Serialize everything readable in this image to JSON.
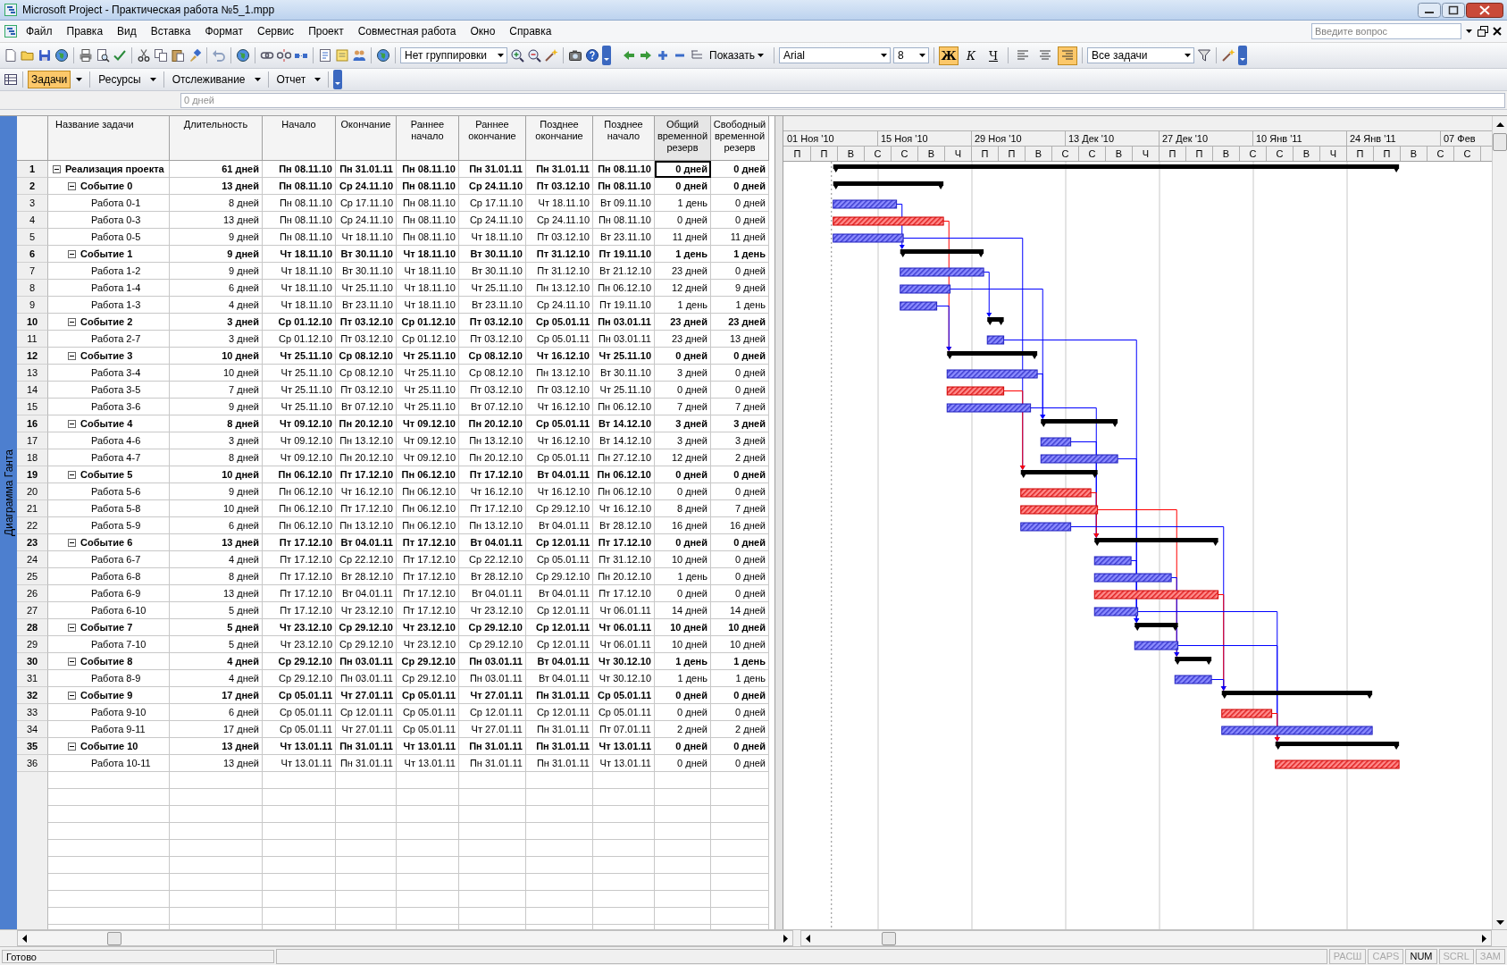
{
  "window": {
    "title": "Microsoft Project - Практическая работа №5_1.mpp"
  },
  "menu": [
    "Файл",
    "Правка",
    "Вид",
    "Вставка",
    "Формат",
    "Сервис",
    "Проект",
    "Совместная работа",
    "Окно",
    "Справка"
  ],
  "question_box": {
    "placeholder": "Введите вопрос"
  },
  "standard_toolbar": {
    "grouping": "Нет группировки"
  },
  "formatting_toolbar": {
    "show": "Показать",
    "font": "Arial",
    "size": "8",
    "styles": [
      {
        "label": "Ж",
        "kind": "bold",
        "selected": true
      },
      {
        "label": "К",
        "kind": "italic",
        "selected": false
      },
      {
        "label": "Ч",
        "kind": "underline",
        "selected": false
      }
    ],
    "alignment": [
      {
        "kind": "left",
        "selected": false
      },
      {
        "kind": "center",
        "selected": false
      },
      {
        "kind": "right",
        "selected": true
      }
    ],
    "filter": "Все задачи"
  },
  "guide_toolbar": [
    {
      "label": "Задачи",
      "selected": true
    },
    {
      "label": "Ресурсы",
      "selected": false
    },
    {
      "label": "Отслеживание",
      "selected": false
    },
    {
      "label": "Отчет",
      "selected": false
    }
  ],
  "entry_bar": {
    "value": "0 дней"
  },
  "view_bar": {
    "label": "Диаграмма Ганта"
  },
  "table": {
    "columns": [
      {
        "label": "Название задачи",
        "focused": false
      },
      {
        "label": "Длительность",
        "focused": false
      },
      {
        "label": "Начало",
        "focused": false
      },
      {
        "label": "Окончание",
        "focused": false
      },
      {
        "label": "Раннее начало",
        "focused": false
      },
      {
        "label": "Раннее окончание",
        "focused": false
      },
      {
        "label": "Позднее окончание",
        "focused": false
      },
      {
        "label": "Позднее начало",
        "focused": false
      },
      {
        "label": "Общий временной резерв",
        "focused": true
      },
      {
        "label": "Свободный временной резерв",
        "focused": false
      }
    ],
    "rows": [
      {
        "number": "1",
        "kind": "summary",
        "expanded": true,
        "focused": true,
        "cells": [
          "Реализация проекта",
          "61 дней",
          "Пн 08.11.10",
          "Пн 31.01.11",
          "Пн 08.11.10",
          "Пн 31.01.11",
          "Пн 31.01.11",
          "Пн 08.11.10",
          "0 дней",
          "0 дней"
        ],
        "children": [
          {
            "number": "2",
            "kind": "summary",
            "expanded": true,
            "focused": false,
            "cells": [
              "Событие 0",
              "13 дней",
              "Пн 08.11.10",
              "Ср 24.11.10",
              "Пн 08.11.10",
              "Ср 24.11.10",
              "Пт 03.12.10",
              "Пн 08.11.10",
              "0 дней",
              "0 дней"
            ],
            "children": [
              {
                "number": "3",
                "kind": "task",
                "critical": false,
                "focused": false,
                "cells": [
                  "Работа 0-1",
                  "8 дней",
                  "Пн 08.11.10",
                  "Ср 17.11.10",
                  "Пн 08.11.10",
                  "Ср 17.11.10",
                  "Чт 18.11.10",
                  "Вт 09.11.10",
                  "1 день",
                  "0 дней"
                ]
              },
              {
                "number": "4",
                "kind": "task",
                "critical": true,
                "focused": false,
                "cells": [
                  "Работа 0-3",
                  "13 дней",
                  "Пн 08.11.10",
                  "Ср 24.11.10",
                  "Пн 08.11.10",
                  "Ср 24.11.10",
                  "Ср 24.11.10",
                  "Пн 08.11.10",
                  "0 дней",
                  "0 дней"
                ]
              },
              {
                "number": "5",
                "kind": "task",
                "critical": false,
                "focused": false,
                "cells": [
                  "Работа 0-5",
                  "9 дней",
                  "Пн 08.11.10",
                  "Чт 18.11.10",
                  "Пн 08.11.10",
                  "Чт 18.11.10",
                  "Пт 03.12.10",
                  "Вт 23.11.10",
                  "11 дней",
                  "11 дней"
                ]
              }
            ]
          },
          {
            "number": "6",
            "kind": "summary",
            "expanded": true,
            "focused": false,
            "cells": [
              "Событие 1",
              "9 дней",
              "Чт 18.11.10",
              "Вт 30.11.10",
              "Чт 18.11.10",
              "Вт 30.11.10",
              "Пт 31.12.10",
              "Пт 19.11.10",
              "1 день",
              "1 день"
            ],
            "children": [
              {
                "number": "7",
                "kind": "task",
                "critical": false,
                "focused": false,
                "cells": [
                  "Работа 1-2",
                  "9 дней",
                  "Чт 18.11.10",
                  "Вт 30.11.10",
                  "Чт 18.11.10",
                  "Вт 30.11.10",
                  "Пт 31.12.10",
                  "Вт 21.12.10",
                  "23 дней",
                  "0 дней"
                ]
              },
              {
                "number": "8",
                "kind": "task",
                "critical": false,
                "focused": false,
                "cells": [
                  "Работа 1-4",
                  "6 дней",
                  "Чт 18.11.10",
                  "Чт 25.11.10",
                  "Чт 18.11.10",
                  "Чт 25.11.10",
                  "Пн 13.12.10",
                  "Пн 06.12.10",
                  "12 дней",
                  "9 дней"
                ]
              },
              {
                "number": "9",
                "kind": "task",
                "critical": false,
                "focused": false,
                "cells": [
                  "Работа 1-3",
                  "4 дней",
                  "Чт 18.11.10",
                  "Вт 23.11.10",
                  "Чт 18.11.10",
                  "Вт 23.11.10",
                  "Ср 24.11.10",
                  "Пт 19.11.10",
                  "1 день",
                  "1 день"
                ]
              }
            ]
          },
          {
            "number": "10",
            "kind": "summary",
            "expanded": true,
            "focused": false,
            "cells": [
              "Событие 2",
              "3 дней",
              "Ср 01.12.10",
              "Пт 03.12.10",
              "Ср 01.12.10",
              "Пт 03.12.10",
              "Ср 05.01.11",
              "Пн 03.01.11",
              "23 дней",
              "23 дней"
            ],
            "children": [
              {
                "number": "11",
                "kind": "task",
                "critical": false,
                "focused": false,
                "cells": [
                  "Работа 2-7",
                  "3 дней",
                  "Ср 01.12.10",
                  "Пт 03.12.10",
                  "Ср 01.12.10",
                  "Пт 03.12.10",
                  "Ср 05.01.11",
                  "Пн 03.01.11",
                  "23 дней",
                  "13 дней"
                ]
              }
            ]
          },
          {
            "number": "12",
            "kind": "summary",
            "expanded": true,
            "focused": false,
            "cells": [
              "Событие 3",
              "10 дней",
              "Чт 25.11.10",
              "Ср 08.12.10",
              "Чт 25.11.10",
              "Ср 08.12.10",
              "Чт 16.12.10",
              "Чт 25.11.10",
              "0 дней",
              "0 дней"
            ],
            "children": [
              {
                "number": "13",
                "kind": "task",
                "critical": false,
                "focused": false,
                "cells": [
                  "Работа 3-4",
                  "10 дней",
                  "Чт 25.11.10",
                  "Ср 08.12.10",
                  "Чт 25.11.10",
                  "Ср 08.12.10",
                  "Пн 13.12.10",
                  "Вт 30.11.10",
                  "3 дней",
                  "0 дней"
                ]
              },
              {
                "number": "14",
                "kind": "task",
                "critical": true,
                "focused": false,
                "cells": [
                  "Работа 3-5",
                  "7 дней",
                  "Чт 25.11.10",
                  "Пт 03.12.10",
                  "Чт 25.11.10",
                  "Пт 03.12.10",
                  "Пт 03.12.10",
                  "Чт 25.11.10",
                  "0 дней",
                  "0 дней"
                ]
              },
              {
                "number": "15",
                "kind": "task",
                "critical": false,
                "focused": false,
                "cells": [
                  "Работа 3-6",
                  "9 дней",
                  "Чт 25.11.10",
                  "Вт 07.12.10",
                  "Чт 25.11.10",
                  "Вт 07.12.10",
                  "Чт 16.12.10",
                  "Пн 06.12.10",
                  "7 дней",
                  "7 дней"
                ]
              }
            ]
          },
          {
            "number": "16",
            "kind": "summary",
            "expanded": true,
            "focused": false,
            "cells": [
              "Событие 4",
              "8 дней",
              "Чт 09.12.10",
              "Пн 20.12.10",
              "Чт 09.12.10",
              "Пн 20.12.10",
              "Ср 05.01.11",
              "Вт 14.12.10",
              "3 дней",
              "3 дней"
            ],
            "children": [
              {
                "number": "17",
                "kind": "task",
                "critical": false,
                "focused": false,
                "cells": [
                  "Работа 4-6",
                  "3 дней",
                  "Чт 09.12.10",
                  "Пн 13.12.10",
                  "Чт 09.12.10",
                  "Пн 13.12.10",
                  "Чт 16.12.10",
                  "Вт 14.12.10",
                  "3 дней",
                  "3 дней"
                ]
              },
              {
                "number": "18",
                "kind": "task",
                "critical": false,
                "focused": false,
                "cells": [
                  "Работа 4-7",
                  "8 дней",
                  "Чт 09.12.10",
                  "Пн 20.12.10",
                  "Чт 09.12.10",
                  "Пн 20.12.10",
                  "Ср 05.01.11",
                  "Пн 27.12.10",
                  "12 дней",
                  "2 дней"
                ]
              }
            ]
          },
          {
            "number": "19",
            "kind": "summary",
            "expanded": true,
            "focused": false,
            "cells": [
              "Событие 5",
              "10 дней",
              "Пн 06.12.10",
              "Пт 17.12.10",
              "Пн 06.12.10",
              "Пт 17.12.10",
              "Вт 04.01.11",
              "Пн 06.12.10",
              "0 дней",
              "0 дней"
            ],
            "children": [
              {
                "number": "20",
                "kind": "task",
                "critical": true,
                "focused": false,
                "cells": [
                  "Работа 5-6",
                  "9 дней",
                  "Пн 06.12.10",
                  "Чт 16.12.10",
                  "Пн 06.12.10",
                  "Чт 16.12.10",
                  "Чт 16.12.10",
                  "Пн 06.12.10",
                  "0 дней",
                  "0 дней"
                ]
              },
              {
                "number": "21",
                "kind": "task",
                "critical": true,
                "focused": false,
                "cells": [
                  "Работа 5-8",
                  "10 дней",
                  "Пн 06.12.10",
                  "Пт 17.12.10",
                  "Пн 06.12.10",
                  "Пт 17.12.10",
                  "Ср 29.12.10",
                  "Чт 16.12.10",
                  "8 дней",
                  "7 дней"
                ]
              },
              {
                "number": "22",
                "kind": "task",
                "critical": false,
                "focused": false,
                "cells": [
                  "Работа 5-9",
                  "6 дней",
                  "Пн 06.12.10",
                  "Пн 13.12.10",
                  "Пн 06.12.10",
                  "Пн 13.12.10",
                  "Вт 04.01.11",
                  "Вт 28.12.10",
                  "16 дней",
                  "16 дней"
                ]
              }
            ]
          },
          {
            "number": "23",
            "kind": "summary",
            "expanded": true,
            "focused": false,
            "cells": [
              "Событие 6",
              "13 дней",
              "Пт 17.12.10",
              "Вт 04.01.11",
              "Пт 17.12.10",
              "Вт 04.01.11",
              "Ср 12.01.11",
              "Пт 17.12.10",
              "0 дней",
              "0 дней"
            ],
            "children": [
              {
                "number": "24",
                "kind": "task",
                "critical": false,
                "focused": false,
                "cells": [
                  "Работа 6-7",
                  "4 дней",
                  "Пт 17.12.10",
                  "Ср 22.12.10",
                  "Пт 17.12.10",
                  "Ср 22.12.10",
                  "Ср 05.01.11",
                  "Пт 31.12.10",
                  "10 дней",
                  "0 дней"
                ]
              },
              {
                "number": "25",
                "kind": "task",
                "critical": false,
                "focused": false,
                "cells": [
                  "Работа 6-8",
                  "8 дней",
                  "Пт 17.12.10",
                  "Вт 28.12.10",
                  "Пт 17.12.10",
                  "Вт 28.12.10",
                  "Ср 29.12.10",
                  "Пн 20.12.10",
                  "1 день",
                  "0 дней"
                ]
              },
              {
                "number": "26",
                "kind": "task",
                "critical": true,
                "focused": false,
                "cells": [
                  "Работа 6-9",
                  "13 дней",
                  "Пт 17.12.10",
                  "Вт 04.01.11",
                  "Пт 17.12.10",
                  "Вт 04.01.11",
                  "Вт 04.01.11",
                  "Пт 17.12.10",
                  "0 дней",
                  "0 дней"
                ]
              },
              {
                "number": "27",
                "kind": "task",
                "critical": false,
                "focused": false,
                "cells": [
                  "Работа 6-10",
                  "5 дней",
                  "Пт 17.12.10",
                  "Чт 23.12.10",
                  "Пт 17.12.10",
                  "Чт 23.12.10",
                  "Ср 12.01.11",
                  "Чт 06.01.11",
                  "14 дней",
                  "14 дней"
                ]
              }
            ]
          },
          {
            "number": "28",
            "kind": "summary",
            "expanded": true,
            "focused": false,
            "cells": [
              "Событие 7",
              "5 дней",
              "Чт 23.12.10",
              "Ср 29.12.10",
              "Чт 23.12.10",
              "Ср 29.12.10",
              "Ср 12.01.11",
              "Чт 06.01.11",
              "10 дней",
              "10 дней"
            ],
            "children": [
              {
                "number": "29",
                "kind": "task",
                "critical": false,
                "focused": false,
                "cells": [
                  "Работа 7-10",
                  "5 дней",
                  "Чт 23.12.10",
                  "Ср 29.12.10",
                  "Чт 23.12.10",
                  "Ср 29.12.10",
                  "Ср 12.01.11",
                  "Чт 06.01.11",
                  "10 дней",
                  "10 дней"
                ]
              }
            ]
          },
          {
            "number": "30",
            "kind": "summary",
            "expanded": true,
            "focused": false,
            "cells": [
              "Событие 8",
              "4 дней",
              "Ср 29.12.10",
              "Пн 03.01.11",
              "Ср 29.12.10",
              "Пн 03.01.11",
              "Вт 04.01.11",
              "Чт 30.12.10",
              "1 день",
              "1 день"
            ],
            "children": [
              {
                "number": "31",
                "kind": "task",
                "critical": false,
                "focused": false,
                "cells": [
                  "Работа 8-9",
                  "4 дней",
                  "Ср 29.12.10",
                  "Пн 03.01.11",
                  "Ср 29.12.10",
                  "Пн 03.01.11",
                  "Вт 04.01.11",
                  "Чт 30.12.10",
                  "1 день",
                  "1 день"
                ]
              }
            ]
          },
          {
            "number": "32",
            "kind": "summary",
            "expanded": true,
            "focused": false,
            "cells": [
              "Событие 9",
              "17 дней",
              "Ср 05.01.11",
              "Чт 27.01.11",
              "Ср 05.01.11",
              "Чт 27.01.11",
              "Пн 31.01.11",
              "Ср 05.01.11",
              "0 дней",
              "0 дней"
            ],
            "children": [
              {
                "number": "33",
                "kind": "task",
                "critical": true,
                "focused": false,
                "cells": [
                  "Работа 9-10",
                  "6 дней",
                  "Ср 05.01.11",
                  "Ср 12.01.11",
                  "Ср 05.01.11",
                  "Ср 12.01.11",
                  "Ср 12.01.11",
                  "Ср 05.01.11",
                  "0 дней",
                  "0 дней"
                ]
              },
              {
                "number": "34",
                "kind": "task",
                "critical": false,
                "focused": false,
                "cells": [
                  "Работа 9-11",
                  "17 дней",
                  "Ср 05.01.11",
                  "Чт 27.01.11",
                  "Ср 05.01.11",
                  "Чт 27.01.11",
                  "Пн 31.01.11",
                  "Пт 07.01.11",
                  "2 дней",
                  "2 дней"
                ]
              }
            ]
          },
          {
            "number": "35",
            "kind": "summary",
            "expanded": true,
            "focused": false,
            "cells": [
              "Событие 10",
              "13 дней",
              "Чт 13.01.11",
              "Пн 31.01.11",
              "Чт 13.01.11",
              "Пн 31.01.11",
              "Пн 31.01.11",
              "Чт 13.01.11",
              "0 дней",
              "0 дней"
            ],
            "children": [
              {
                "number": "36",
                "kind": "task",
                "critical": true,
                "focused": false,
                "cells": [
                  "Работа 10-11",
                  "13 дней",
                  "Чт 13.01.11",
                  "Пн 31.01.11",
                  "Чт 13.01.11",
                  "Пн 31.01.11",
                  "Пн 31.01.11",
                  "Чт 13.01.11",
                  "0 дней",
                  "0 дней"
                ]
              }
            ]
          }
        ]
      }
    ]
  },
  "gantt": {
    "timescale": {
      "major": [
        "01 Ноя '10",
        "15 Ноя '10",
        "29 Ноя '10",
        "13 Дек '10",
        "27 Дек '10",
        "10 Янв '11",
        "24 Янв '11",
        "07 Фев"
      ],
      "minor": [
        "П",
        "П",
        "В",
        "С",
        "С",
        "В",
        "Ч",
        "П",
        "П",
        "В",
        "С",
        "С",
        "В",
        "Ч",
        "П",
        "П",
        "В",
        "С",
        "С",
        "В",
        "Ч",
        "П",
        "П",
        "В",
        "С",
        "С"
      ]
    }
  },
  "status_bar": {
    "text": "Готово",
    "indicators": [
      {
        "label": "РАСШ",
        "on": false
      },
      {
        "label": "CAPS",
        "on": false
      },
      {
        "label": "NUM",
        "on": true
      },
      {
        "label": "SCRL",
        "on": false
      },
      {
        "label": "ЗАМ",
        "on": false
      }
    ]
  }
}
